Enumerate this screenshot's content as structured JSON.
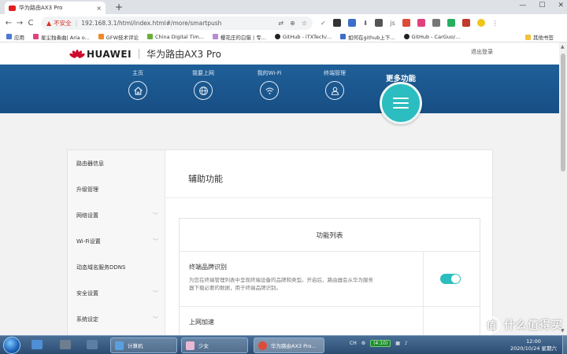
{
  "browser": {
    "tab_title": "华为路由AX3 Pro",
    "tab_close": "×",
    "new_tab": "+",
    "window_controls": [
      "—",
      "☐",
      "✕"
    ],
    "nav": {
      "back": "←",
      "forward": "→",
      "reload": "C"
    },
    "insecure_label": "不安全",
    "url": "192.168.3.1/html/index.html#/more/smartpush",
    "bookmarks": [
      {
        "label": "应用",
        "color": "#4a7bd4"
      },
      {
        "label": "星尘独奏曲| Aria o...",
        "color": "#e0417e"
      },
      {
        "label": "GFW技术评论",
        "color": "#f08a24"
      },
      {
        "label": "China Digital Tim...",
        "color": "#6cae3a"
      },
      {
        "label": "樱花庄的白猫 | 专...",
        "color": "#b88bd6"
      },
      {
        "label": "GitHub - iTXTech/...",
        "color": "#222222"
      },
      {
        "label": "如何在github上下...",
        "color": "#3b6fc9"
      },
      {
        "label": "GitHub - CarGuo/...",
        "color": "#222222"
      }
    ],
    "other_bookmarks": "其他书签"
  },
  "header": {
    "brand": "HUAWEI",
    "product": "华为路由AX3 Pro",
    "logout": "退出登录"
  },
  "nav": {
    "items": [
      {
        "label": "主页",
        "icon": "home-icon"
      },
      {
        "label": "我要上网",
        "icon": "globe-icon"
      },
      {
        "label": "我的Wi-Fi",
        "icon": "wifi-icon"
      },
      {
        "label": "终端管理",
        "icon": "user-icon"
      }
    ],
    "active_label": "更多功能",
    "active_icon": "menu-icon"
  },
  "sidebar": {
    "items": [
      {
        "label": "路由器信息",
        "chevron": ""
      },
      {
        "label": "升级管理",
        "chevron": ""
      },
      {
        "label": "网络设置",
        "chevron": "﹀"
      },
      {
        "label": "Wi-Fi设置",
        "chevron": "﹀"
      },
      {
        "label": "动态域名服务DDNS",
        "chevron": ""
      },
      {
        "label": "安全设置",
        "chevron": "﹀"
      },
      {
        "label": "系统设定",
        "chevron": "﹀"
      }
    ]
  },
  "main": {
    "title": "辅助功能",
    "panel_title": "功能列表",
    "features": [
      {
        "name": "终端品牌识别",
        "description_line1": "为您在终端管理列表中呈现终端设备的品牌和类型。开启后，路由器会从华为服务",
        "description_line2": "器下载必要的数据，用于终端品牌识别。",
        "enabled": true
      },
      {
        "name": "上网加速"
      }
    ]
  },
  "taskbar": {
    "tasks": [
      {
        "label": "计算机",
        "color": "#5aa0dd"
      },
      {
        "label": "少女",
        "color": "#e9b8d6"
      },
      {
        "label": "华为路由AX3 Pro...",
        "color": "#dd4b39"
      }
    ],
    "tray_lang": "CH",
    "battery": "(4:10)",
    "clock_time": "12:00",
    "clock_date": "2020/10/24 星期六"
  },
  "watermark": {
    "logo": "值",
    "text": "什么值得买"
  },
  "colors": {
    "accent": "#2bbdbf",
    "nav_blue": "#1f5f98",
    "huawei_red": "#cf0a2c"
  }
}
